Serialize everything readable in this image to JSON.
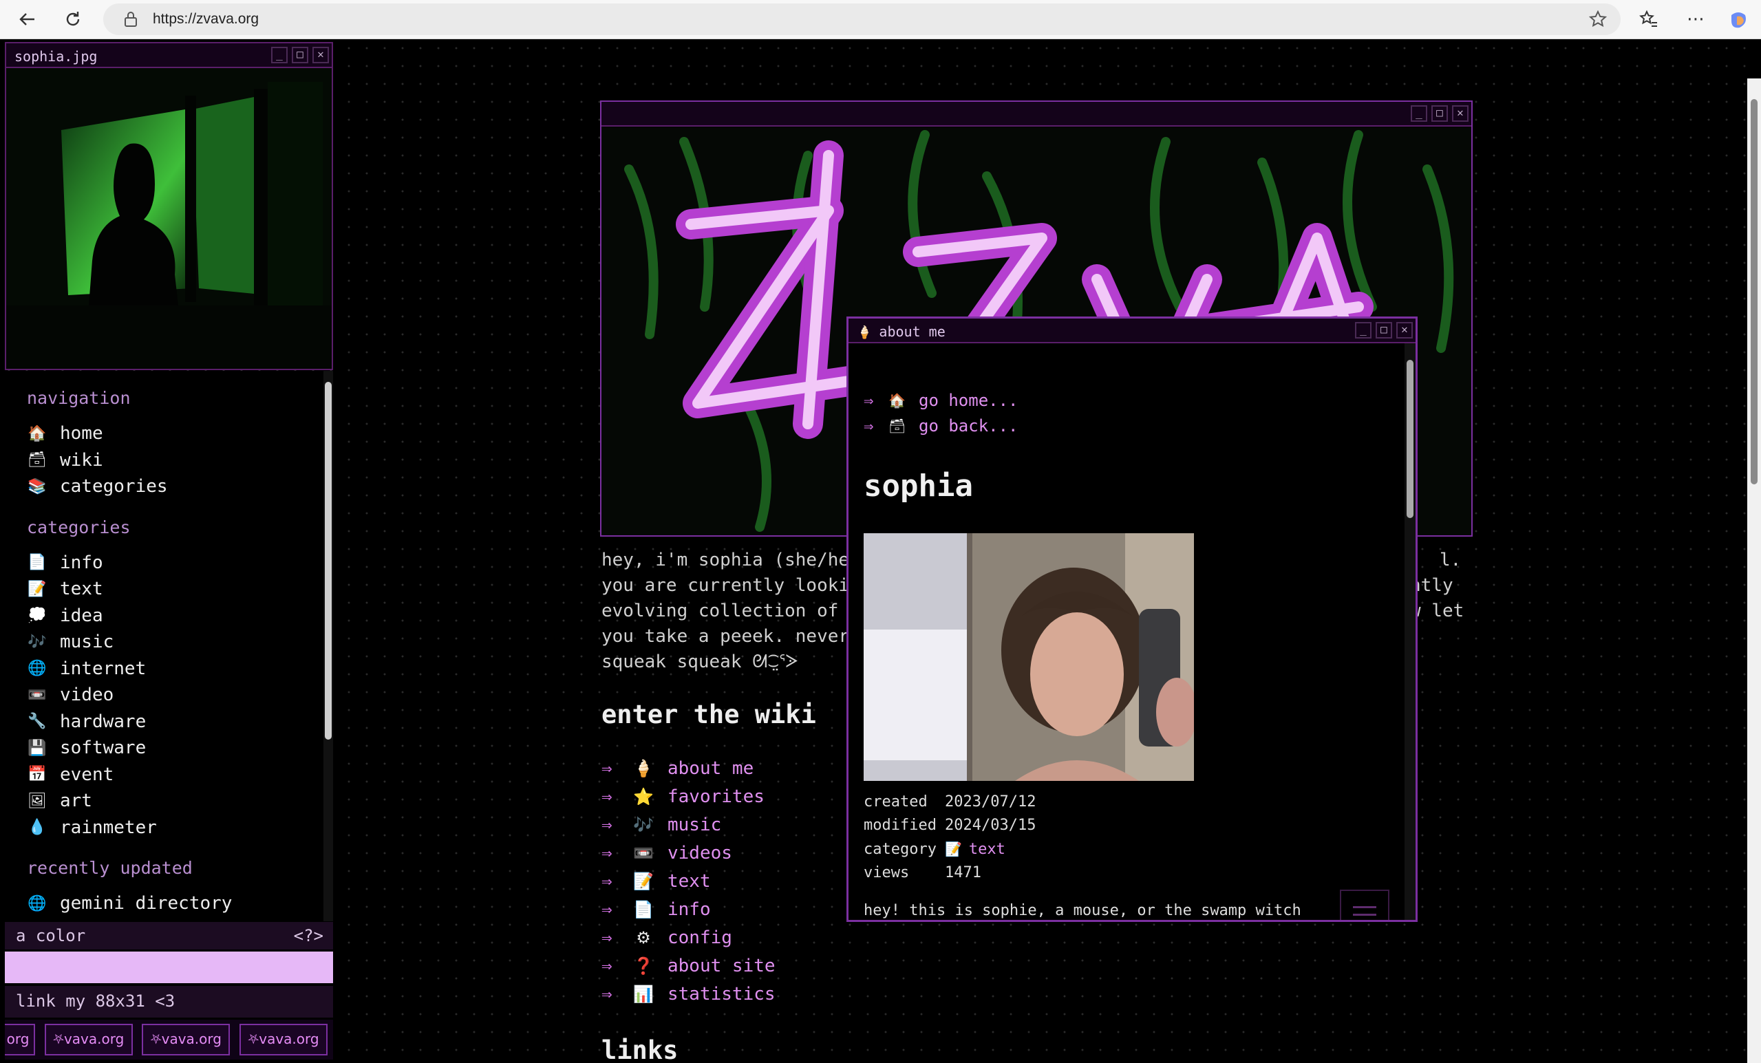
{
  "browser": {
    "url": "https://zvava.org"
  },
  "photo_window": {
    "title": "sophia.jpg"
  },
  "nav": {
    "navigation_heading": "navigation",
    "navigation_items": [
      {
        "icon": "🏠",
        "label": "home"
      },
      {
        "icon": "🗃",
        "label": "wiki"
      },
      {
        "icon": "📚",
        "label": "categories"
      }
    ],
    "categories_heading": "categories",
    "category_items": [
      {
        "icon": "📄",
        "label": "info"
      },
      {
        "icon": "📝",
        "label": "text"
      },
      {
        "icon": "💭",
        "label": "idea"
      },
      {
        "icon": "🎶",
        "label": "music"
      },
      {
        "icon": "🌐",
        "label": "internet"
      },
      {
        "icon": "📼",
        "label": "video"
      },
      {
        "icon": "🔧",
        "label": "hardware"
      },
      {
        "icon": "💾",
        "label": "software"
      },
      {
        "icon": "📅",
        "label": "event"
      },
      {
        "icon": "🖼",
        "label": "art"
      },
      {
        "icon": "💧",
        "label": "rainmeter"
      }
    ],
    "recent_heading": "recently updated",
    "recent_items": [
      {
        "icon": "🌐",
        "label": "gemini directory"
      }
    ]
  },
  "color_bar": {
    "label": "a color",
    "hint": "<?>",
    "swatch": "#e6b8f7"
  },
  "link_bar": {
    "label": "link my 88x31 <3",
    "badge_text": "⛧vava.org",
    "badge_partial": "org"
  },
  "intro": {
    "lines": [
      "hey, i'm sophia (she/he",
      "you are currently looki",
      "evolving collection of",
      "you take a peeek. never",
      "squeak squeak ᘛ⁐̤ᕐᐷ"
    ],
    "lines_right": [
      "l.",
      "ntly",
      "w let",
      "",
      ""
    ]
  },
  "wiki": {
    "heading": "enter the wiki",
    "arrow": "⇒",
    "items": [
      {
        "icon": "🍦",
        "label": "about me"
      },
      {
        "icon": "⭐",
        "label": "favorites"
      },
      {
        "icon": "🎶",
        "label": "music"
      },
      {
        "icon": "📼",
        "label": "videos"
      },
      {
        "icon": "📝",
        "label": "text"
      },
      {
        "icon": "📄",
        "label": "info"
      },
      {
        "icon": "⚙",
        "label": "config"
      },
      {
        "icon": "❓",
        "label": "about site"
      },
      {
        "icon": "📊",
        "label": "statistics"
      }
    ]
  },
  "links_heading": "links",
  "about_window": {
    "title": "about me",
    "title_icon": "🍦",
    "go_home": "go home...",
    "go_back": "go back...",
    "name": "sophia",
    "meta": {
      "created_label": "created",
      "created": "2023/07/12",
      "modified_label": "modified",
      "modified": "2024/03/15",
      "category_label": "category",
      "category": "text",
      "category_icon": "📝",
      "views_label": "views",
      "views": "1471"
    },
    "description": "hey! this is sophie, a mouse, or the swamp witch"
  },
  "colors": {
    "accent": "#7b2fa0",
    "link": "#e090f0",
    "arrow": "#d070e0"
  }
}
